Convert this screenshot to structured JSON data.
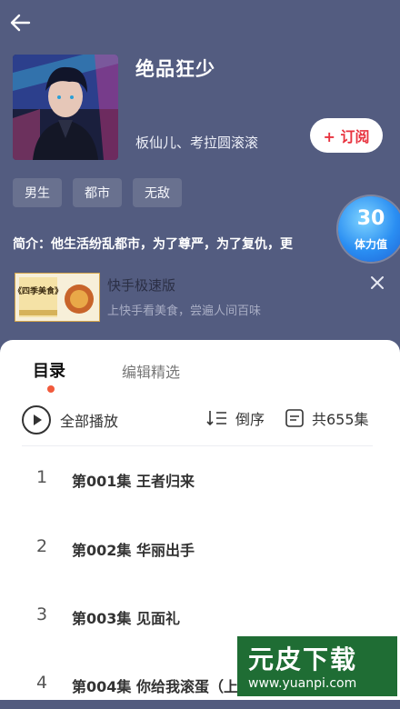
{
  "colors": {
    "header_bg": "#535c80",
    "accent_red": "#e8333f",
    "energy_blue": "#2a8ef2",
    "active_dot": "#f15a3c"
  },
  "header": {
    "title": "绝品狂少",
    "authors": "板仙儿、考拉圆滚滚",
    "subscribe_label": "+ 订阅",
    "tags": [
      "男生",
      "都市",
      "无敌"
    ],
    "intro": "简介：他生活纷乱都市，为了尊严，为了复仇，更"
  },
  "energy": {
    "value": "30",
    "label": "体力值"
  },
  "ad": {
    "thumb_text": "《四季美食》",
    "title": "快手极速版",
    "desc": "上快手看美食，尝遍人间百味"
  },
  "catalog": {
    "tabs": [
      "目录",
      "编辑精选"
    ],
    "play_all": "全部播放",
    "sort_label": "倒序",
    "count_label": "共655集",
    "episodes": [
      {
        "num": "1",
        "title": "第001集 王者归来"
      },
      {
        "num": "2",
        "title": "第002集 华丽出手"
      },
      {
        "num": "3",
        "title": "第003集 见面礼"
      },
      {
        "num": "4",
        "title": "第004集 你给我滚蛋（上）"
      }
    ]
  },
  "watermark": {
    "top": "元皮下载",
    "bottom": "www.yuanpi.com"
  }
}
